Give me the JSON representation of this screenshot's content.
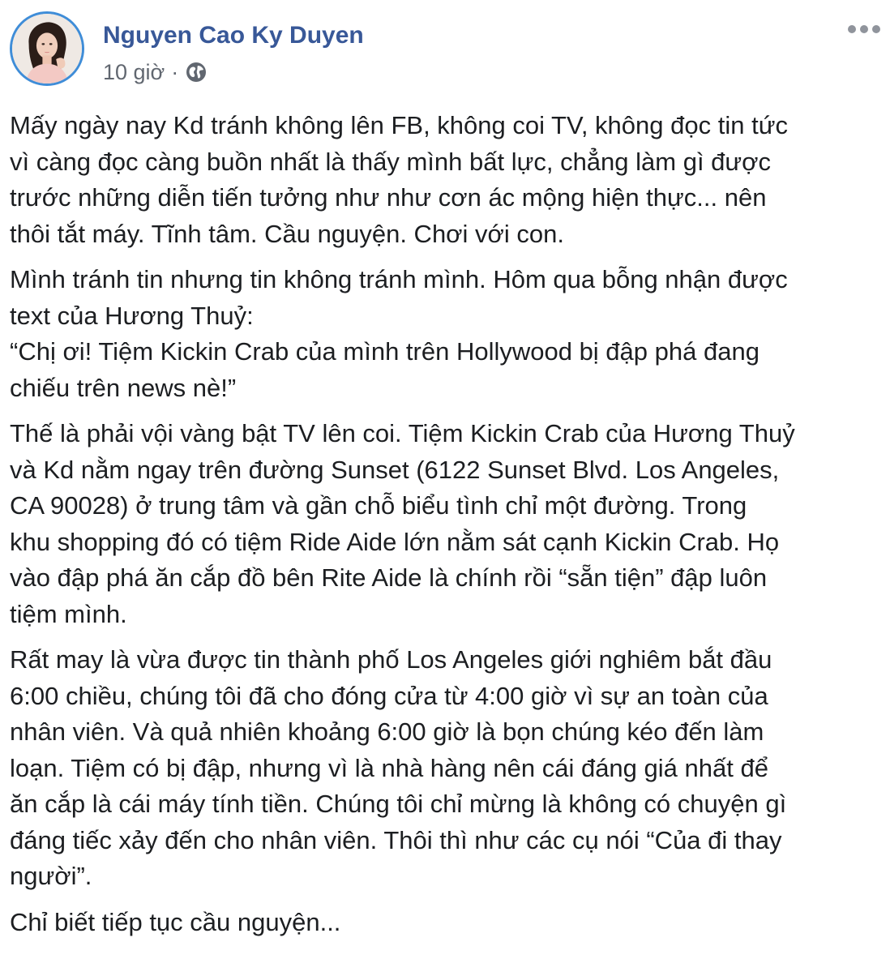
{
  "author": {
    "name": "Nguyen Cao Ky Duyen",
    "avatar_icon": "avatar-photo"
  },
  "meta": {
    "time": "10 giờ",
    "separator": "·",
    "privacy_icon": "globe-icon"
  },
  "more_icon": "more-options-icon",
  "colors": {
    "author_name": "#385898",
    "avatar_ring": "#3f8dd8",
    "meta_text": "#616770",
    "body_text": "#1c1e21"
  },
  "paragraphs": [
    "Mấy ngày nay Kd tránh không lên FB, không coi TV, không đọc tin tức\nvì càng đọc càng buồn nhất là thấy mình bất lực, chẳng làm gì được\ntrước những diễn tiến tưởng như như cơn ác mộng hiện thực... nên\nthôi tắt máy. Tĩnh tâm. Cầu nguyện. Chơi với con.",
    "Mình tránh tin nhưng tin không tránh mình. Hôm qua bỗng nhận được\ntext của Hương Thuỷ:\n“Chị ơi! Tiệm Kickin Crab của mình trên Hollywood bị đập phá đang\nchiếu trên news nè!”",
    "Thế là phải vội vàng bật TV lên coi. Tiệm Kickin Crab của Hương Thuỷ\nvà Kd nằm ngay trên đường Sunset (6122 Sunset Blvd. Los Angeles,\nCA 90028) ở trung tâm và gần chỗ biểu tình chỉ một đường. Trong\nkhu shopping đó có tiệm Ride Aide lớn nằm sát cạnh Kickin Crab. Họ\nvào đập phá ăn cắp đồ bên Rite Aide là chính rồi “sẵn tiện” đập luôn\ntiệm mình.",
    "Rất may là vừa được tin thành phố Los Angeles giới nghiêm bắt đầu\n6:00 chiều, chúng tôi đã cho đóng cửa từ 4:00 giờ vì sự an toàn của\nnhân viên. Và quả nhiên khoảng 6:00 giờ là bọn chúng kéo đến làm\nloạn. Tiệm có bị đập, nhưng vì là nhà hàng nên cái đáng giá nhất để\năn cắp là cái máy tính tiền. Chúng tôi chỉ mừng là không có chuyện gì\nđáng tiếc xảy đến cho nhân viên. Thôi thì như các cụ nói “Của đi thay\nngười”.",
    "Chỉ biết tiếp tục cầu nguyện..."
  ]
}
